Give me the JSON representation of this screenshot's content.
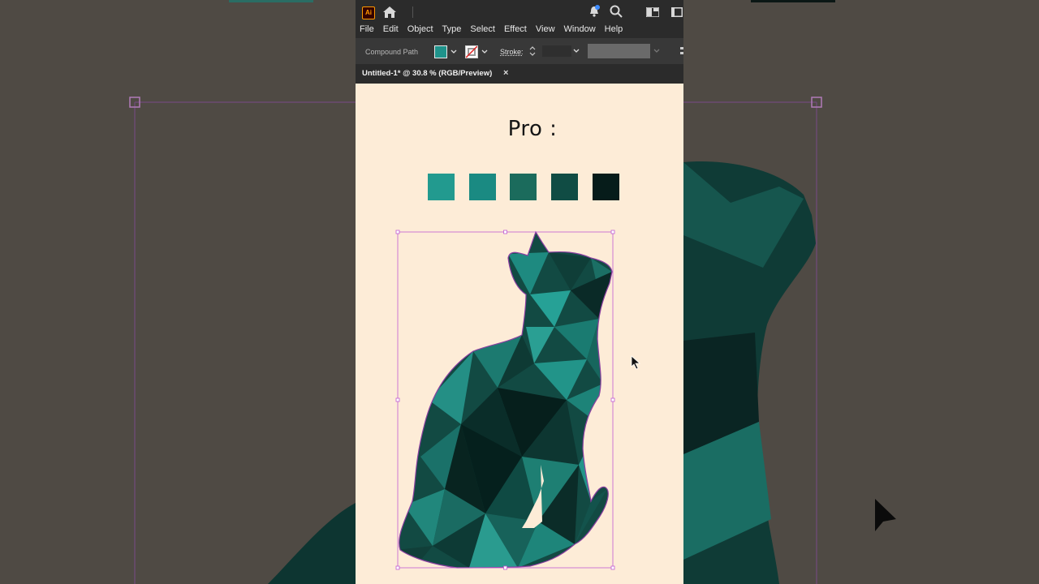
{
  "app": {
    "logo_text": "Ai",
    "menu": [
      "File",
      "Edit",
      "Object",
      "Type",
      "Select",
      "Effect",
      "View",
      "Window",
      "Help"
    ],
    "control_bar": {
      "selection_type": "Compound Path",
      "fill_color": "#1f938b",
      "stroke_label": "Stroke:"
    },
    "document_tab": {
      "title": "Untitled-1* @ 30.8 % (RGB/Preview)",
      "close": "×"
    }
  },
  "artboard": {
    "heading": "Pro :",
    "palette": [
      "#229a8f",
      "#1a8a82",
      "#1b6b5c",
      "#104c44",
      "#061c1a"
    ],
    "artwork": "low-poly-cat"
  },
  "colors": {
    "ui_dark": "#2b2b2b",
    "ui_control": "#383838",
    "artboard_bg": "#fdecd7",
    "selection": "#c15bd3"
  }
}
